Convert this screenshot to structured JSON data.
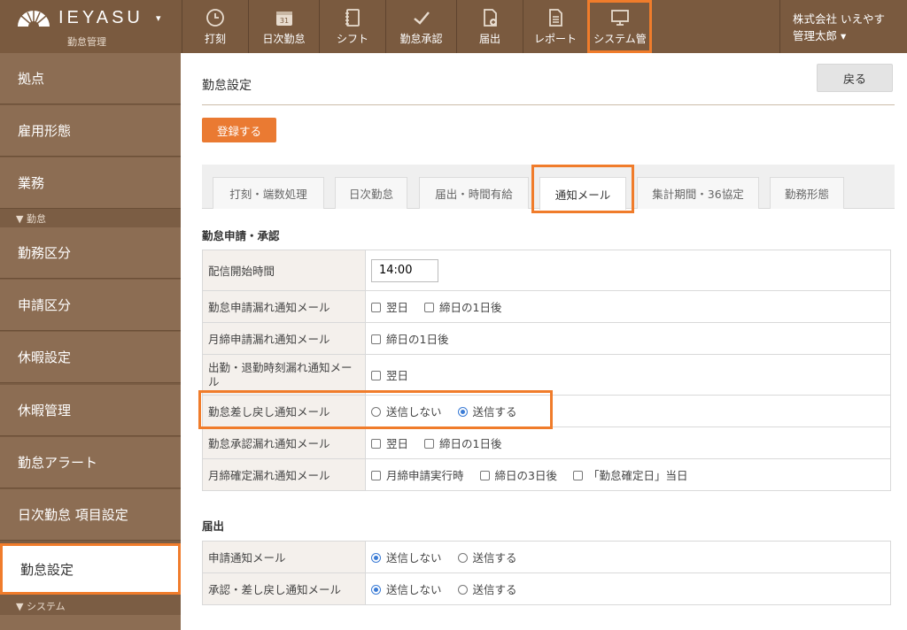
{
  "header": {
    "brand": "IEYASU",
    "brand_caret": "▾",
    "subtitle": "勤怠管理",
    "nav": [
      {
        "label": "打刻",
        "icon": "clock-icon"
      },
      {
        "label": "日次勤怠",
        "icon": "calendar-icon"
      },
      {
        "label": "シフト",
        "icon": "notebook-icon"
      },
      {
        "label": "勤怠承認",
        "icon": "checkmark-icon"
      },
      {
        "label": "届出",
        "icon": "document-add-icon"
      },
      {
        "label": "レポート",
        "icon": "report-icon"
      },
      {
        "label": "システム管",
        "icon": "monitor-icon"
      }
    ],
    "company": "株式会社 いえやす",
    "user": "管理太郎",
    "user_caret": "▾"
  },
  "sidebar": {
    "items": [
      {
        "label": "拠点"
      },
      {
        "label": "雇用形態"
      },
      {
        "label": "業務"
      },
      {
        "label": "勤務区分"
      },
      {
        "label": "申請区分"
      },
      {
        "label": "休暇設定"
      },
      {
        "label": "休暇管理"
      },
      {
        "label": "勤怠アラート"
      },
      {
        "label": "日次勤怠 項目設定"
      },
      {
        "label": "勤怠設定"
      }
    ],
    "sections": [
      "▼ 勤怠",
      "▼ システム"
    ]
  },
  "main": {
    "title": "勤怠設定",
    "back_label": "戻る",
    "register_label": "登録する",
    "tabs": [
      {
        "label": "打刻・端数処理"
      },
      {
        "label": "日次勤怠"
      },
      {
        "label": "届出・時間有給"
      },
      {
        "label": "通知メール"
      },
      {
        "label": "集計期間・36協定"
      },
      {
        "label": "勤務形態"
      }
    ],
    "section1_title": "勤怠申請・承認",
    "rows1": [
      {
        "label": "配信開始時間",
        "time": "14:00"
      },
      {
        "label": "勤怠申請漏れ通知メール",
        "opts": [
          "翌日",
          "締日の1日後"
        ]
      },
      {
        "label": "月締申請漏れ通知メール",
        "opts": [
          "締日の1日後"
        ]
      },
      {
        "label": "出勤・退勤時刻漏れ通知メール",
        "opts": [
          "翌日"
        ]
      },
      {
        "label": "勤怠差し戻し通知メール",
        "opts": [
          "送信しない",
          "送信する"
        ]
      },
      {
        "label": "勤怠承認漏れ通知メール",
        "opts": [
          "翌日",
          "締日の1日後"
        ]
      },
      {
        "label": "月締確定漏れ通知メール",
        "opts": [
          "月締申請実行時",
          "締日の3日後",
          "「勤怠確定日」当日"
        ]
      }
    ],
    "section2_title": "届出",
    "rows2": [
      {
        "label": "申請通知メール",
        "opts": [
          "送信しない",
          "送信する"
        ]
      },
      {
        "label": "承認・差し戻し通知メール",
        "opts": [
          "送信しない",
          "送信する"
        ]
      }
    ]
  },
  "colors": {
    "header_bg": "#7a5a3f",
    "sidebar_bg": "#8c6d53",
    "accent": "#ea7a32",
    "highlight": "#f07c2b",
    "radio_on": "#3a7bd5"
  }
}
